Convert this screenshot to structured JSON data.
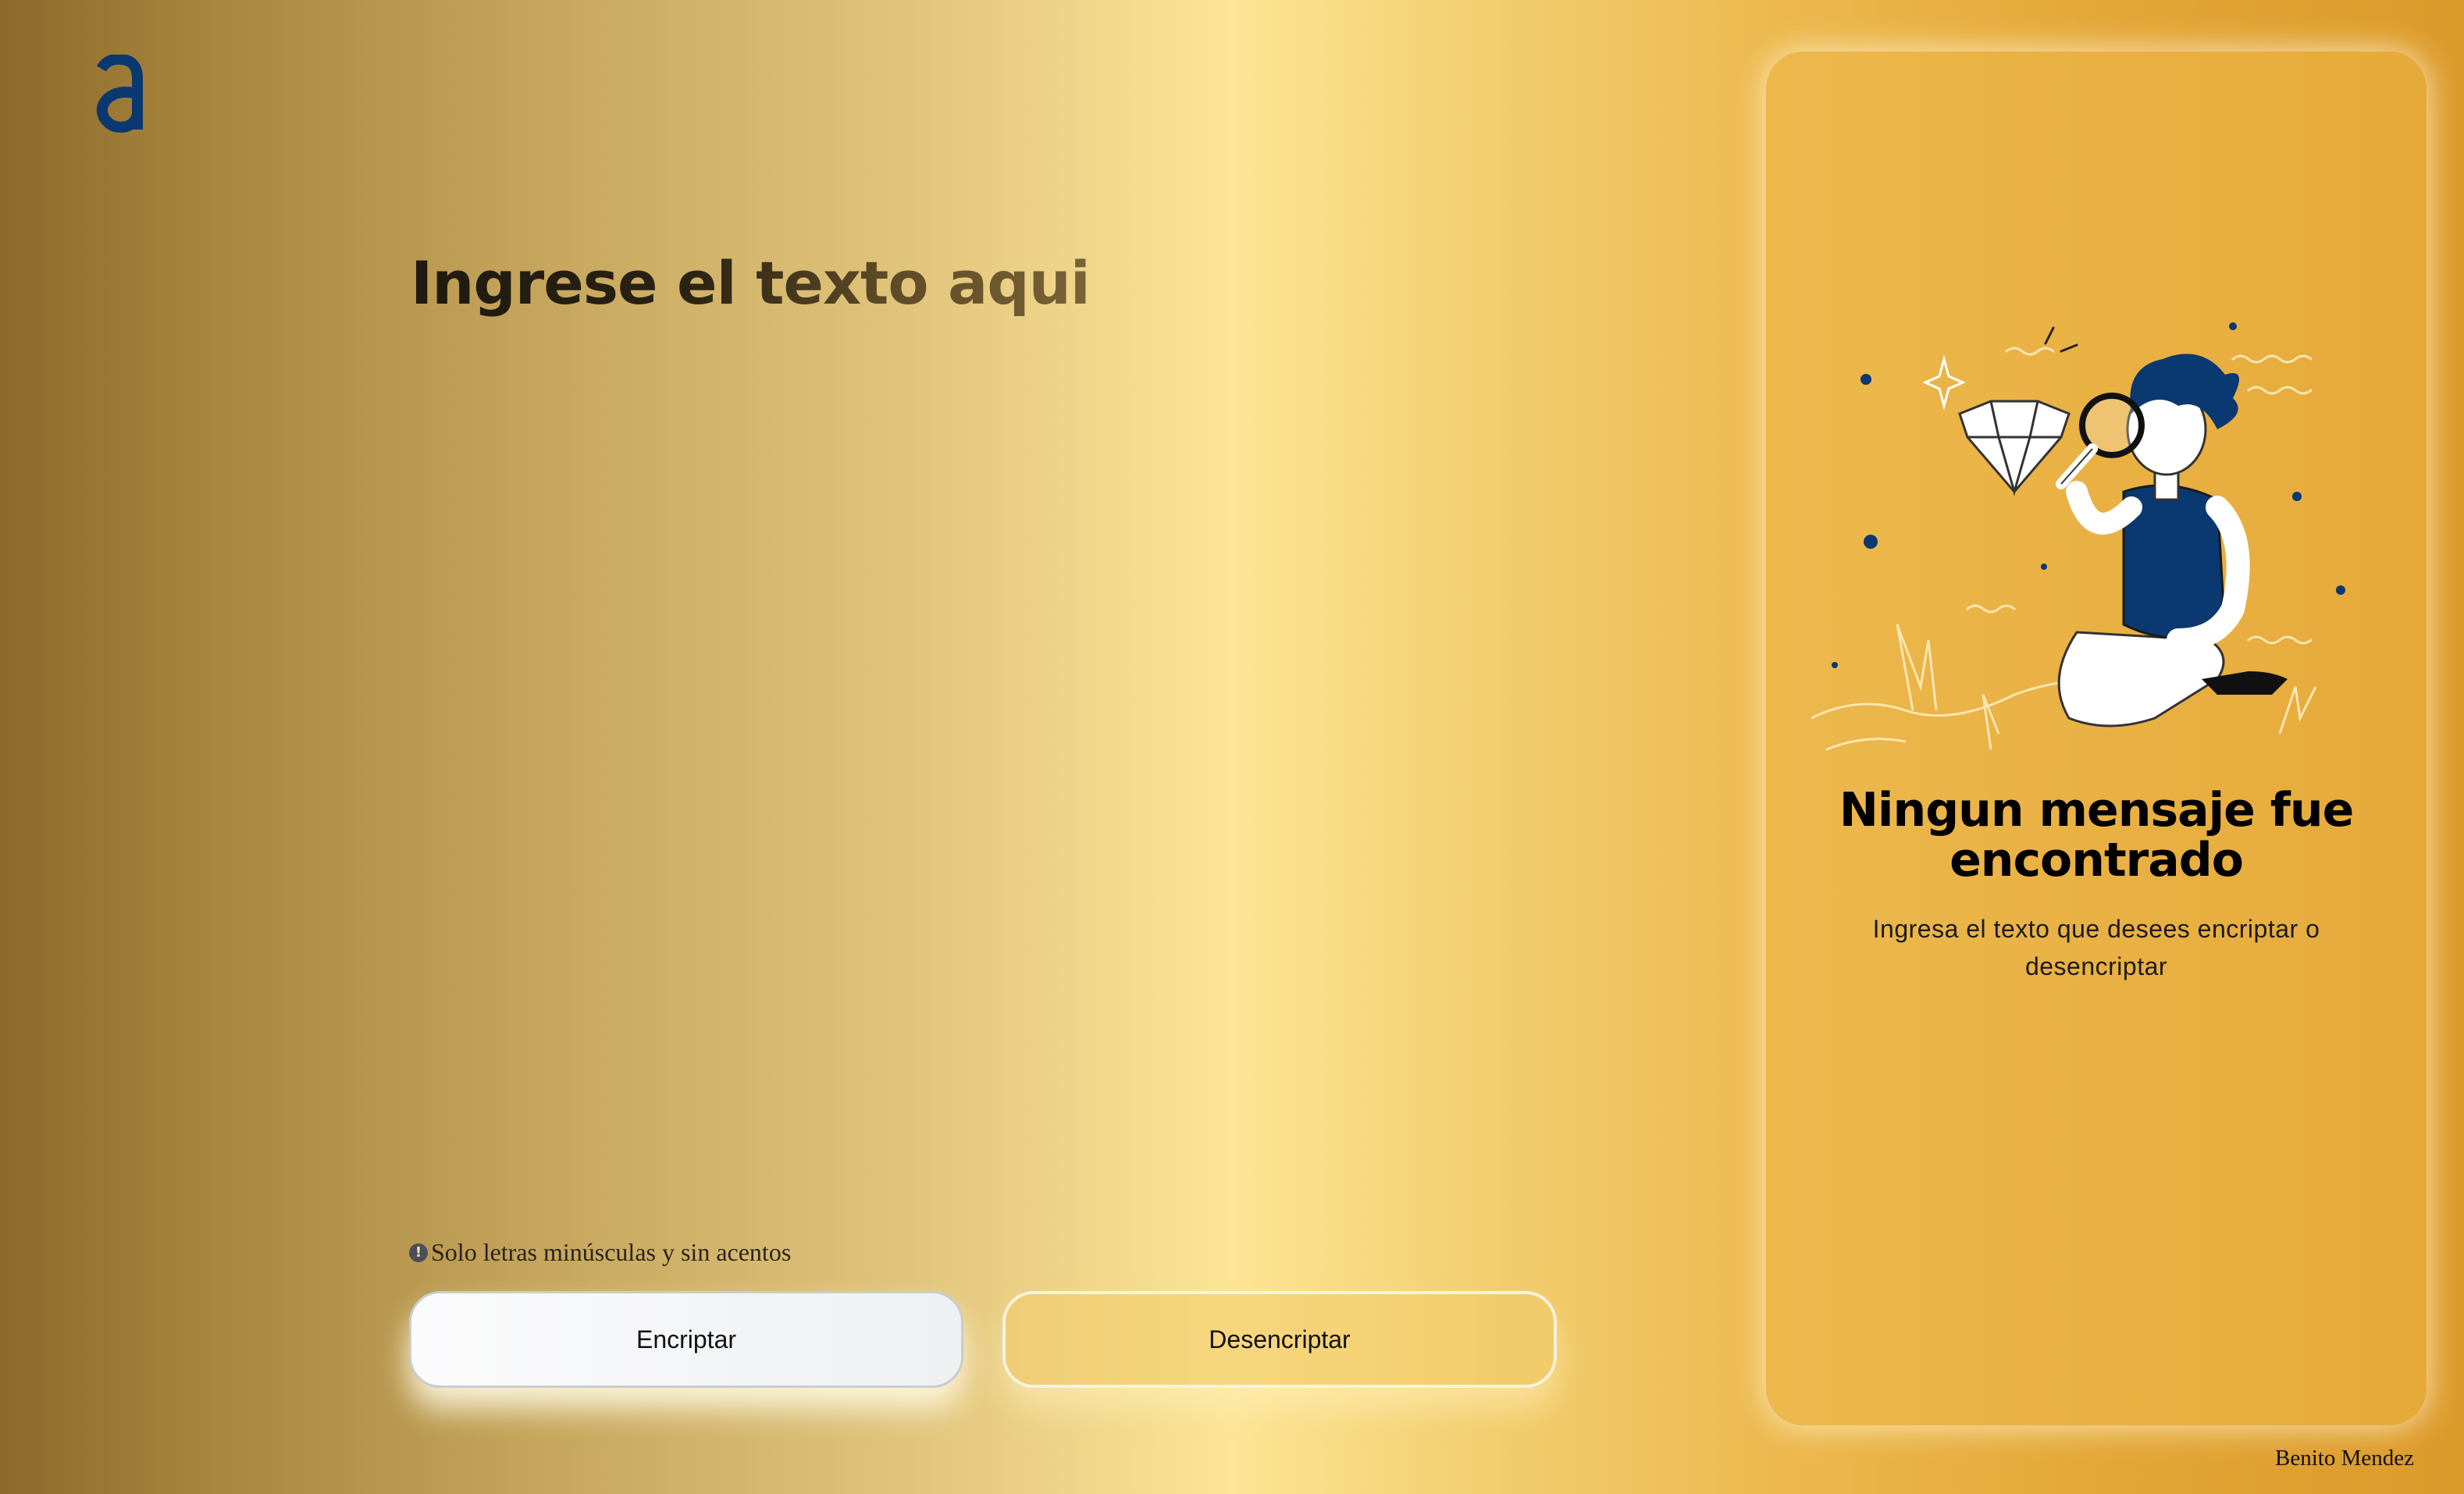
{
  "logo": {
    "icon": "alura-a-logo",
    "color": "#0a3871"
  },
  "input": {
    "heading": "Ingrese el texto aqui",
    "value": ""
  },
  "hint": {
    "icon": "info-circle-icon",
    "text": "Solo letras minúsculas y sin acentos"
  },
  "buttons": {
    "encrypt_label": "Encriptar",
    "decrypt_label": "Desencriptar"
  },
  "output_panel": {
    "illustration": "person-with-magnifying-glass-and-diamond",
    "title": "Ningun mensaje fue encontrado",
    "text": "Ingresa el texto que desees encriptar o desencriptar"
  },
  "footer": {
    "author": "Benito Mendez"
  },
  "colors": {
    "accent_blue": "#0a3871",
    "panel": "#e8ae40",
    "background_gold": "#fce595"
  }
}
